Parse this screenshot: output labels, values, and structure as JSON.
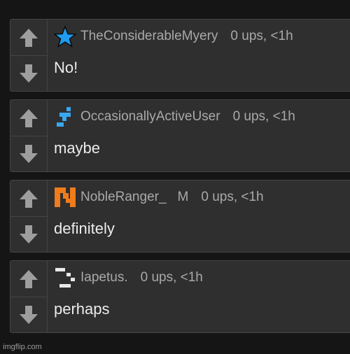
{
  "colors": {
    "background": "#151515",
    "panel": "#2f2f2f",
    "border": "#454545",
    "meta_text": "#a9a9a9",
    "body_text": "#ececec",
    "arrow": "#9e9e9e",
    "star_blue": "#1e9cf0",
    "user2_blue": "#3aa6f0",
    "user3_orange": "#f07c1c"
  },
  "comments": [
    {
      "avatar_icon": "blue-star-icon",
      "username": "TheConsiderableMyery",
      "badge": "",
      "score": "0 ups, <1h",
      "text": "No!"
    },
    {
      "avatar_icon": "blue-pixel-figure-icon",
      "username": "OccasionallyActiveUser",
      "badge": "",
      "score": "0 ups, <1h",
      "text": "maybe"
    },
    {
      "avatar_icon": "orange-pixel-n-icon",
      "username": "NobleRanger_",
      "badge": "M",
      "score": "0 ups, <1h",
      "text": "definitely"
    },
    {
      "avatar_icon": "white-pixel-blocks-icon",
      "username": "Iapetus.",
      "badge": "",
      "score": "0 ups, <1h",
      "text": "perhaps"
    }
  ],
  "watermark": "imgflip.com"
}
